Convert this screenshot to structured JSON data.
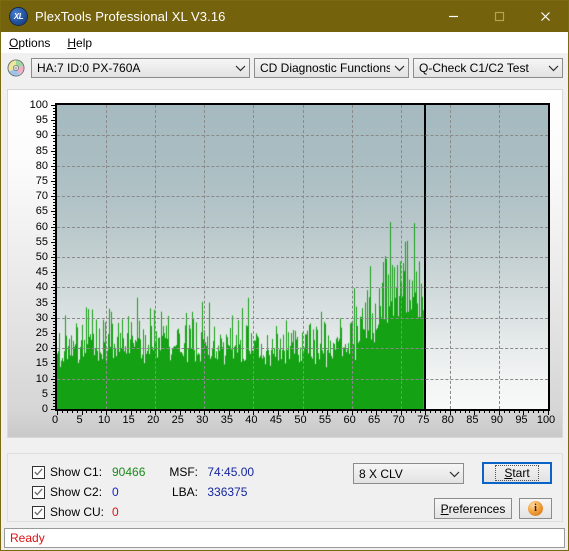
{
  "window": {
    "title": "PlexTools Professional XL V3.16",
    "app_icon": "xl-disc-icon",
    "icon_text": "XL",
    "titlebar_color": "#75620d",
    "minimize_label": "Minimize",
    "maximize_label": "Maximize",
    "close_label": "Close"
  },
  "menubar": {
    "items": [
      {
        "label": "Options",
        "accel": "O"
      },
      {
        "label": "Help",
        "accel": "H"
      }
    ]
  },
  "toolbar": {
    "disc_icon": "cd-disc-icon",
    "drive_combo": {
      "value": "HA:7 ID:0  PX-760A",
      "icon": "chevron-down-icon"
    },
    "function_combo": {
      "value": "CD Diagnostic Functions",
      "icon": "chevron-down-icon"
    },
    "test_combo": {
      "value": "Q-Check C1/C2 Test",
      "icon": "chevron-down-icon"
    }
  },
  "chart_data": {
    "type": "bar",
    "title": "",
    "xlabel": "",
    "ylabel": "",
    "xlim": [
      0,
      100
    ],
    "ylim": [
      0,
      100
    ],
    "xticks": [
      0,
      5,
      10,
      15,
      20,
      25,
      30,
      35,
      40,
      45,
      50,
      55,
      60,
      65,
      70,
      75,
      80,
      85,
      90,
      95,
      100
    ],
    "yticks": [
      0,
      5,
      10,
      15,
      20,
      25,
      30,
      35,
      40,
      45,
      50,
      55,
      60,
      65,
      70,
      75,
      80,
      85,
      90,
      95,
      100
    ],
    "grid": true,
    "legend_position": "none",
    "series_color": "#14a114",
    "data_end_x": 74.8,
    "end_marker_color": "#000000",
    "series": [
      {
        "name": "C1",
        "color": "#14a114",
        "x_start": 0,
        "x_end": 74.8,
        "values": [
          25,
          22,
          28,
          24,
          21,
          26,
          23,
          20,
          25,
          27,
          22,
          24,
          26,
          23,
          25,
          21,
          28,
          24,
          22,
          26,
          25,
          23,
          27,
          31,
          24,
          22,
          35,
          25,
          23,
          27,
          24,
          26,
          22,
          28,
          25,
          30,
          23,
          27,
          25,
          24,
          29,
          26,
          23,
          42,
          27,
          25,
          31,
          24,
          28,
          22,
          26,
          30,
          25,
          23,
          27,
          37,
          26,
          24,
          29,
          25,
          32,
          27,
          23,
          35,
          26,
          24,
          38,
          28,
          25,
          31,
          27,
          23,
          34,
          26,
          29,
          24,
          32,
          27,
          25,
          30,
          28,
          24,
          35,
          26,
          23,
          29,
          33,
          25,
          27,
          24,
          31,
          26,
          22,
          36,
          28,
          24,
          30,
          26,
          23,
          33,
          27,
          25,
          29,
          24,
          31,
          26,
          22,
          28,
          34,
          25,
          27,
          23,
          30,
          26,
          24,
          32,
          28,
          25,
          29,
          23,
          27,
          31,
          24,
          26,
          22,
          35,
          28,
          25,
          30,
          23,
          27,
          26,
          24,
          33,
          29,
          25,
          31,
          22,
          27,
          26,
          24,
          28,
          30,
          23,
          26,
          32,
          25,
          27,
          24,
          29,
          22,
          31,
          26,
          28,
          23,
          27,
          25,
          30,
          24,
          26,
          22,
          29,
          27,
          24,
          33,
          25,
          23,
          28,
          26,
          30,
          22,
          27,
          24,
          29,
          25,
          23,
          31,
          26,
          28,
          22,
          27,
          24,
          30,
          25,
          23,
          29,
          26,
          22,
          28,
          24,
          27,
          31,
          23,
          26,
          25,
          22,
          29,
          24,
          28,
          26,
          23,
          30,
          25,
          22,
          27,
          24,
          29,
          26,
          23,
          28,
          22,
          25,
          31,
          24,
          27,
          23,
          26,
          29,
          22,
          25,
          28,
          23,
          26,
          24,
          30,
          22,
          27,
          25,
          23,
          28,
          26,
          24,
          22,
          29,
          25,
          23,
          27,
          22,
          26,
          24,
          28,
          23,
          25,
          30,
          22,
          26,
          24,
          27,
          23,
          25,
          29,
          22,
          26,
          24,
          28,
          23,
          27,
          25,
          22,
          26,
          31,
          24,
          23,
          28,
          26,
          22,
          25,
          29,
          24,
          27,
          23,
          26,
          22,
          30,
          25,
          24,
          28,
          23,
          26,
          22,
          27,
          25,
          31,
          23,
          26,
          24,
          22,
          29,
          27,
          25,
          23,
          28,
          26,
          22,
          24,
          30,
          27,
          25,
          23,
          26,
          28,
          24,
          22,
          29,
          25,
          27,
          23,
          26,
          31,
          24,
          22,
          28,
          26,
          25,
          23,
          30,
          27,
          24,
          26,
          22,
          29,
          25,
          23,
          27,
          26,
          24,
          32,
          28,
          25,
          23,
          27,
          30,
          26,
          24,
          22,
          29,
          27,
          25,
          23,
          31,
          26,
          24,
          28,
          22,
          27,
          25,
          30,
          23,
          26,
          29,
          24,
          27,
          22,
          25,
          33,
          28,
          26,
          24,
          30,
          27,
          23,
          26,
          31,
          25,
          28,
          24,
          22,
          29,
          27,
          34,
          26,
          24,
          30,
          28,
          25,
          23,
          32,
          27,
          26,
          29,
          24,
          31,
          28,
          26,
          35,
          30,
          27,
          25,
          33,
          29,
          26,
          32,
          28,
          36,
          31,
          27,
          34,
          30,
          28,
          33,
          38,
          31,
          29,
          36,
          33,
          40,
          34,
          31,
          37,
          42,
          35,
          33,
          39,
          44,
          37,
          34,
          41,
          46,
          38,
          36,
          43,
          40,
          48,
          41,
          38,
          45,
          43,
          50,
          44,
          41,
          47,
          52,
          45,
          42,
          49,
          46,
          54,
          47,
          44,
          51,
          48,
          56,
          49,
          46,
          53,
          58,
          50,
          47,
          55,
          52,
          60,
          51,
          48,
          57,
          53,
          50,
          55,
          47,
          52,
          49,
          56,
          51,
          48,
          54,
          50,
          46,
          53,
          49,
          45,
          51,
          48,
          44,
          50,
          47,
          43,
          49,
          46,
          42,
          48,
          45
        ]
      }
    ]
  },
  "results": {
    "checkboxes": [
      {
        "label": "Show C1:",
        "value": "90466",
        "color": "#1a8a1a",
        "checked": true,
        "name": "show-c1"
      },
      {
        "label": "Show C2:",
        "value": "0",
        "color": "#1823c8",
        "checked": true,
        "name": "show-c2"
      },
      {
        "label": "Show CU:",
        "value": "0",
        "color": "#e01111",
        "checked": true,
        "name": "show-cu"
      }
    ],
    "msf": {
      "label": "MSF:",
      "value": "74:45.00"
    },
    "lba": {
      "label": "LBA:",
      "value": "336375"
    }
  },
  "controls": {
    "speed_combo": {
      "value": "8 X CLV",
      "icon": "chevron-down-icon"
    },
    "start_button": {
      "label": "Start",
      "accel": "S"
    },
    "preferences_button": {
      "label": "Preferences",
      "accel": "P"
    },
    "info_button": {
      "glyph": "i",
      "name": "info-icon"
    }
  },
  "statusbar": {
    "text": "Ready",
    "color": "#e01111"
  }
}
